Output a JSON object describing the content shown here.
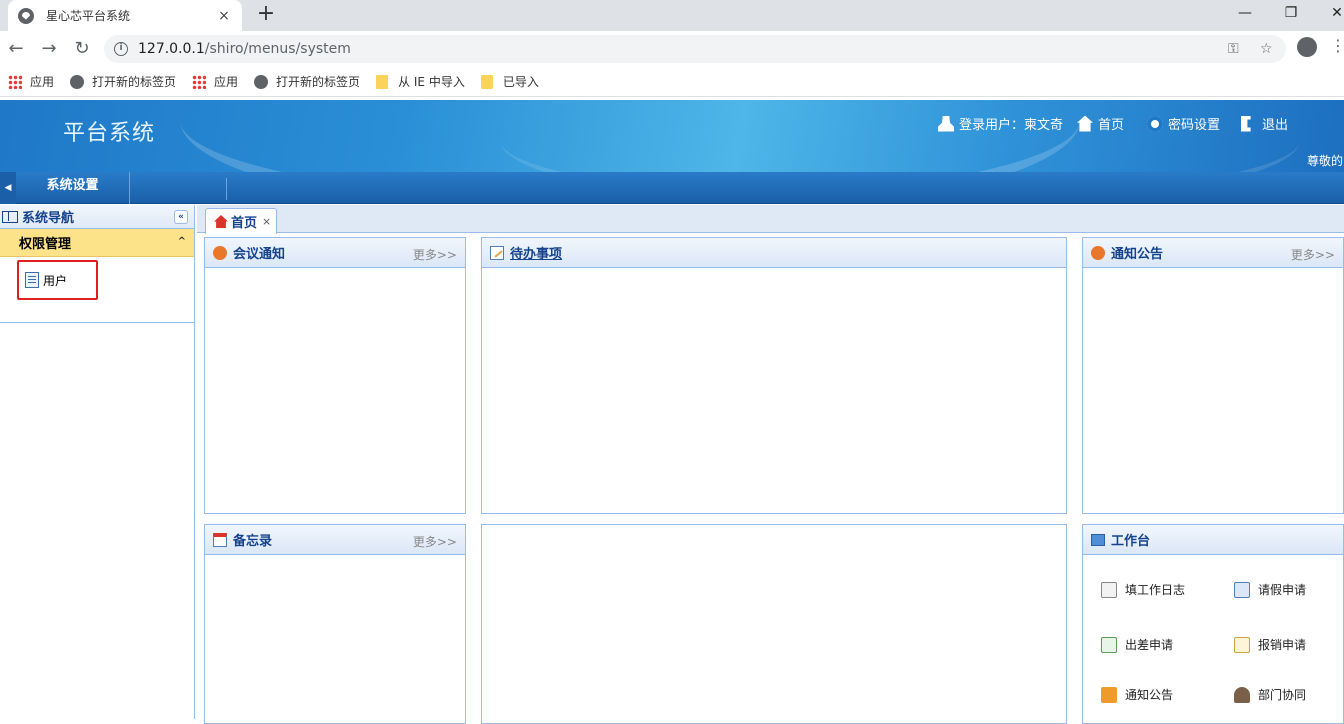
{
  "browser": {
    "tab_title": "星心芯平台系统",
    "tab_close": "×",
    "new_tab": "+",
    "win_min": "—",
    "win_restore": "❐",
    "win_close": "✕",
    "back": "←",
    "forward": "→",
    "reload": "↻",
    "url_host": "127.0.0.1",
    "url_path": "/shiro/menus/system",
    "key_glyph": "⚿",
    "star_glyph": "☆",
    "menu_glyph": "⋮",
    "bookmarks": [
      "应用",
      "打开新的标签页",
      "应用",
      "打开新的标签页",
      "从 IE 中导入",
      "已导入"
    ]
  },
  "header": {
    "title": "平台系统",
    "login_user": "登录用户：柬文奇",
    "home": "首页",
    "password": "密码设置",
    "logout": "退出",
    "welcome": "尊敬的"
  },
  "menubar": {
    "toggle": "◀",
    "item": "系统设置"
  },
  "sidebar": {
    "title": "系统导航",
    "collapse": "«",
    "group": "权限管理",
    "group_toggle": "^",
    "items": [
      {
        "label": "用户"
      }
    ]
  },
  "content": {
    "tab_label": "首页",
    "tab_close": "×",
    "panels": {
      "meeting": {
        "title": "会议通知",
        "more": "更多>>"
      },
      "todo": {
        "title": "待办事项"
      },
      "notice": {
        "title": "通知公告",
        "more": "更多>>"
      },
      "memo": {
        "title": "备忘录",
        "more": "更多>>"
      },
      "workbench": {
        "title": "工作台"
      }
    },
    "workbench_items": [
      "填工作日志",
      "请假申请",
      "出差申请",
      "报销申请",
      "通知公告",
      "部门协同"
    ]
  },
  "colors": {
    "accent": "#15428b",
    "header_blue": "#2a8fd6",
    "group_yellow": "#fce38a",
    "highlight_red": "#e02020"
  }
}
